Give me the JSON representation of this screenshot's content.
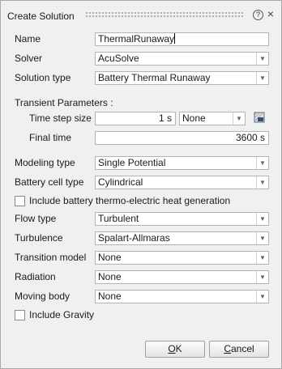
{
  "window": {
    "title": "Create Solution",
    "help_icon": "question-circle-icon",
    "close_icon": "close-icon",
    "help_glyph": "?",
    "close_glyph": "×"
  },
  "fields": {
    "name_label": "Name",
    "name_value": "ThermalRunaway",
    "solver_label": "Solver",
    "solver_value": "AcuSolve",
    "solution_type_label": "Solution type",
    "solution_type_value": "Battery Thermal Runaway"
  },
  "transient": {
    "section_label": "Transient Parameters :",
    "time_step_label": "Time step size",
    "time_step_value": "1 s",
    "time_step_option": "None",
    "unit_icon": "unit-settings-icon",
    "final_time_label": "Final time",
    "final_time_value": "3600 s"
  },
  "battery": {
    "modeling_type_label": "Modeling type",
    "modeling_type_value": "Single Potential",
    "cell_type_label": "Battery cell type",
    "cell_type_value": "Cylindrical",
    "thermo_electric_label": "Include battery thermo-electric heat generation",
    "thermo_electric_checked": false
  },
  "flow": {
    "flow_type_label": "Flow type",
    "flow_type_value": "Turbulent",
    "turbulence_label": "Turbulence",
    "turbulence_value": "Spalart-Allmaras",
    "transition_label": "Transition model",
    "transition_value": "None",
    "radiation_label": "Radiation",
    "radiation_value": "None",
    "moving_body_label": "Moving body",
    "moving_body_value": "None",
    "gravity_label": "Include Gravity",
    "gravity_checked": false
  },
  "buttons": {
    "ok_mnemonic": "O",
    "ok_rest": "K",
    "cancel_mnemonic": "C",
    "cancel_rest": "ancel"
  },
  "icons": {
    "dropdown_arrow": "▼"
  }
}
